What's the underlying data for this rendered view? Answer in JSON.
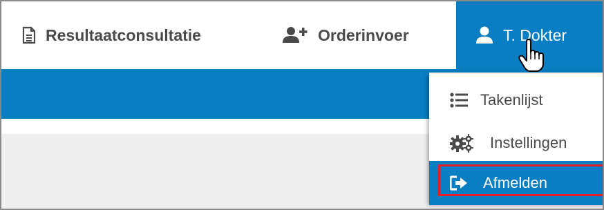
{
  "nav": {
    "results": {
      "label": "Resultaatconsultatie",
      "icon": "document-icon"
    },
    "order": {
      "label": "Orderinvoer",
      "icon": "add-user-icon"
    },
    "user": {
      "label": "T. Dokter",
      "icon": "user-icon"
    }
  },
  "menu": {
    "items": [
      {
        "label": "Takenlijst",
        "icon": "list-icon"
      },
      {
        "label": "Instellingen",
        "icon": "gears-icon"
      },
      {
        "label": "Afmelden",
        "icon": "sign-out-icon"
      }
    ]
  },
  "colors": {
    "accent": "#0a7ec2",
    "highlight": "#e01f26",
    "text": "#4a4a4a",
    "body_bg": "#efefef"
  }
}
